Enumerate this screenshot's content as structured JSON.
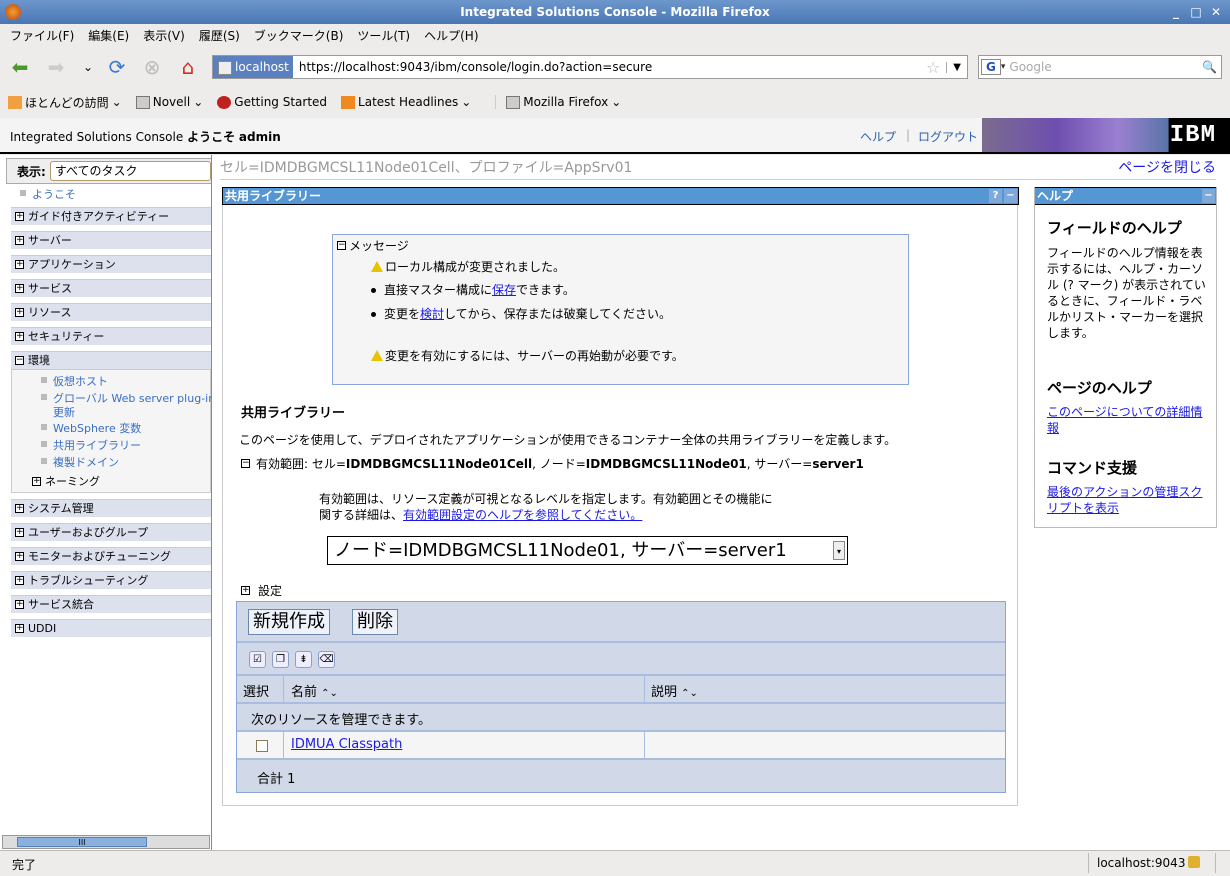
{
  "window": {
    "title": "Integrated Solutions Console - Mozilla Firefox"
  },
  "menu": [
    "ファイル(F)",
    "編集(E)",
    "表示(V)",
    "履歴(S)",
    "ブックマーク(B)",
    "ツール(T)",
    "ヘルプ(H)"
  ],
  "urlbar": {
    "site": "localhost",
    "url": "https://localhost:9043/ibm/console/login.do?action=secure"
  },
  "search": {
    "placeholder": "Google"
  },
  "bookmarks": [
    "ほとんどの訪問",
    "Novell",
    "Getting Started",
    "Latest Headlines",
    "Mozilla Firefox"
  ],
  "console": {
    "title": "Integrated Solutions Console",
    "welcome": "ようこそ",
    "user": "admin",
    "help": "ヘルプ",
    "logout": "ログアウト",
    "logo": "IBM"
  },
  "nav": {
    "view_label": "表示:",
    "view_value": "すべてのタスク",
    "welcome": "ようこそ",
    "sections": [
      "ガイド付きアクティビティー",
      "サーバー",
      "アプリケーション",
      "サービス",
      "リソース",
      "セキュリティー",
      "環境",
      "システム管理",
      "ユーザーおよびグループ",
      "モニターおよびチューニング",
      "トラブルシューティング",
      "サービス統合",
      "UDDI"
    ],
    "env_items": [
      "仮想ホスト",
      "グローバル Web server plug-in",
      "更新",
      "WebSphere 変数",
      "共用ライブラリー",
      "複製ドメイン"
    ],
    "naming": "ネーミング"
  },
  "main": {
    "breadcrumb": "セル=IDMDBGMCSL11Node01Cell、プロファイル=AppSrv01",
    "close_page": "ページを閉じる",
    "portlet_title": "共用ライブラリー",
    "messages": {
      "title": "メッセージ",
      "line1": "ローカル構成が変更されました。",
      "line2a": "直接マスター構成に",
      "line2link": "保存",
      "line2b": "できます。",
      "line3a": "変更を",
      "line3link": "検討",
      "line3b": "してから、保存または破棄してください。",
      "line4": "変更を有効にするには、サーバーの再始動が必要です。"
    },
    "heading": "共用ライブラリー",
    "description": "このページを使用して、デプロイされたアプリケーションが使用できるコンテナー全体の共用ライブラリーを定義します。",
    "scope_label": "有効範囲: セル=",
    "scope_cell": "IDMDBGMCSL11Node01Cell",
    "scope_node_label": ", ノード=",
    "scope_node": "IDMDBGMCSL11Node01",
    "scope_server_label": ", サーバー=",
    "scope_server": "server1",
    "scope_desc1": "有効範囲は、リソース定義が可視となるレベルを指定します。有効範囲とその機能に",
    "scope_desc2": "関する詳細は、",
    "scope_link": "有効範囲設定のヘルプを参照してください。",
    "scope_select": "ノード=IDMDBGMCSL11Node01, サーバー=server1",
    "settings": "設定",
    "new_button": "新規作成",
    "delete_button": "削除",
    "columns": [
      "選択",
      "名前",
      "説明"
    ],
    "manage_text": "次のリソースを管理できます。",
    "rows": [
      {
        "name": "IDMUA Classpath",
        "description": ""
      }
    ],
    "total": "合計 1"
  },
  "help": {
    "title": "ヘルプ",
    "field_help_title": "フィールドのヘルプ",
    "field_help_text": "フィールドのヘルプ情報を表示するには、ヘルプ・カーソル (? マーク) が表示されているときに、フィールド・ラベルかリスト・マーカーを選択します。",
    "page_help_title": "ページのヘルプ",
    "page_help_link": "このページについての詳細情報",
    "command_title": "コマンド支援",
    "command_link": "最後のアクションの管理スクリプトを表示"
  },
  "status": {
    "text": "完了",
    "host": "localhost:9043"
  }
}
